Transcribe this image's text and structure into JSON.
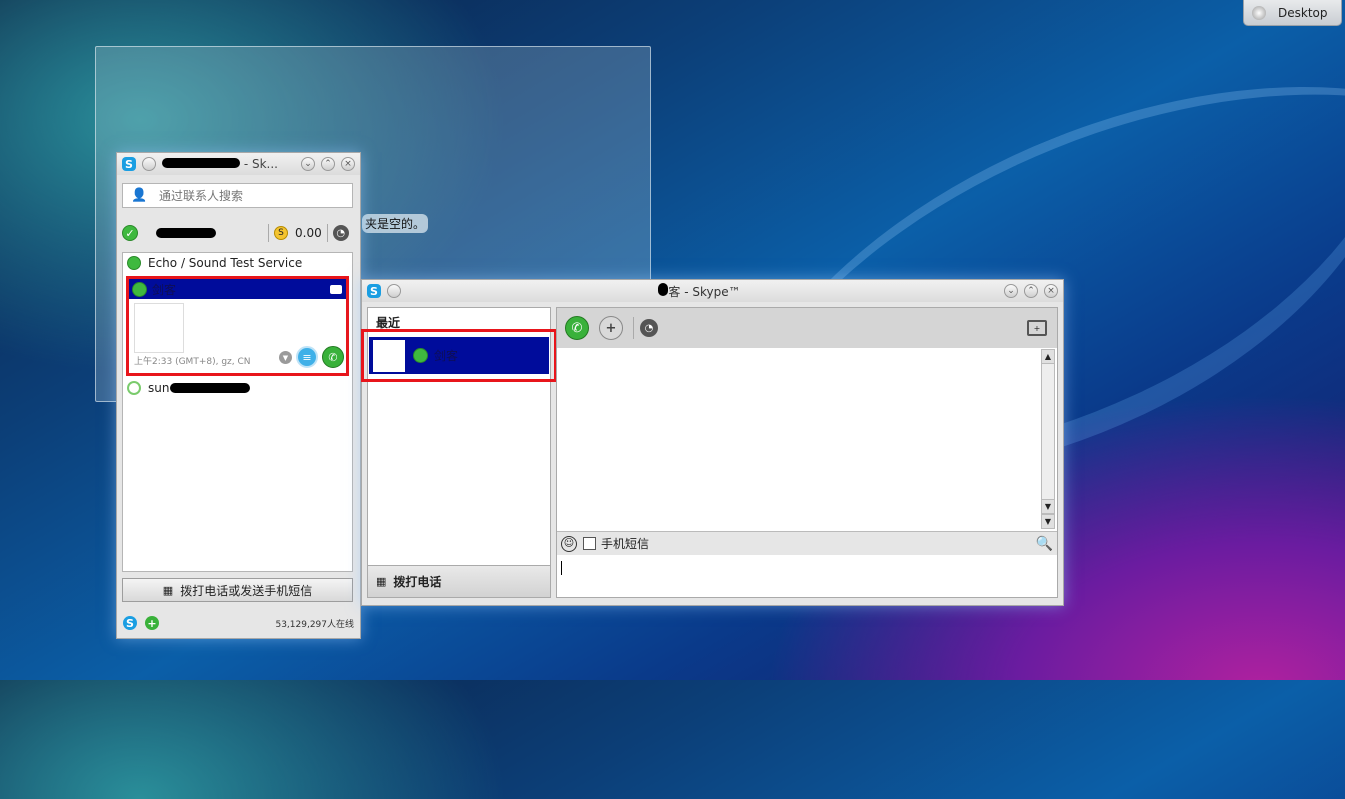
{
  "desktop": {
    "label": "Desktop"
  },
  "background_pane": {
    "text": "夹是空的。"
  },
  "main_window": {
    "title": "- Sk...",
    "search": {
      "placeholder": "通过联系人搜索"
    },
    "credit": "0.00",
    "contacts": [
      {
        "name": "Echo / Sound Test Service",
        "status": "online"
      },
      {
        "name": "剑客",
        "status": "online",
        "selected": true,
        "local_time": "上午2:33 (GMT+8), gz, CN"
      },
      {
        "name": "sun",
        "status": "offline"
      }
    ],
    "dial_button": "拨打电话或发送手机短信",
    "online_count": "53,129,297人在线"
  },
  "chat_window": {
    "title": "客 - Skype™",
    "recent_header": "最近",
    "recent_item": "剑客",
    "dial_label": "拨打电话",
    "sms_label": "手机短信"
  },
  "icons": {
    "skype": "skype-logo-icon",
    "status_online": "online-status-icon",
    "clock": "history-clock-icon",
    "coin": "skype-credit-icon"
  },
  "colors": {
    "selection_bg": "#000c9b",
    "highlight_border": "#e8151b",
    "online_green": "#3fb93f",
    "skype_blue": "#1a9ee2"
  }
}
